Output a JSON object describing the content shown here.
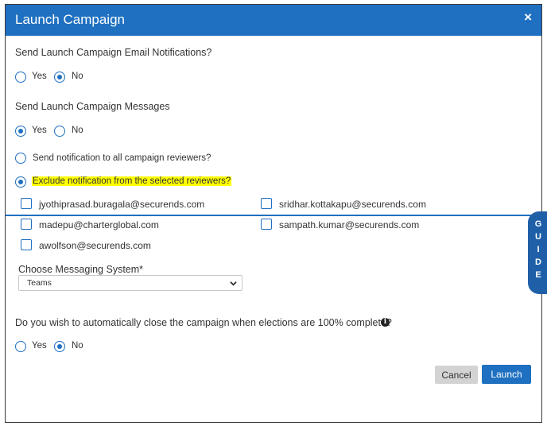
{
  "dialog": {
    "title": "Launch Campaign",
    "close_label": "×"
  },
  "email_notifications": {
    "question": "Send Launch Campaign Email Notifications?",
    "options": [
      "Yes",
      "No"
    ],
    "selected": "No"
  },
  "messages": {
    "question": "Send Launch Campaign Messages",
    "options": [
      "Yes",
      "No"
    ],
    "selected": "Yes"
  },
  "notification_scope": {
    "all_reviewers": "Send notification to all campaign reviewers?",
    "exclude_selected": "Exclude notification from the selected reviewers?",
    "selected": "exclude_selected"
  },
  "reviewers": [
    {
      "email": "jyothiprasad.buragala@securends.com",
      "checked": false
    },
    {
      "email": "sridhar.kottakapu@securends.com",
      "checked": false
    },
    {
      "email": "madepu@charterglobal.com",
      "checked": false
    },
    {
      "email": "sampath.kumar@securends.com",
      "checked": false
    },
    {
      "email": "awolfson@securends.com",
      "checked": false
    }
  ],
  "messaging_system": {
    "label": "Choose Messaging System*",
    "value": "Teams"
  },
  "auto_close": {
    "question": "Do you wish to automatically close the campaign when elections are 100% complete?",
    "options": [
      "Yes",
      "No"
    ],
    "selected": "No"
  },
  "footer": {
    "cancel_label": "Cancel",
    "launch_label": "Launch"
  },
  "guide_tab": {
    "letters": [
      "G",
      "U",
      "I",
      "D",
      "E"
    ]
  },
  "colors": {
    "primary": "#1f70c1",
    "highlight": "#ffff00"
  }
}
